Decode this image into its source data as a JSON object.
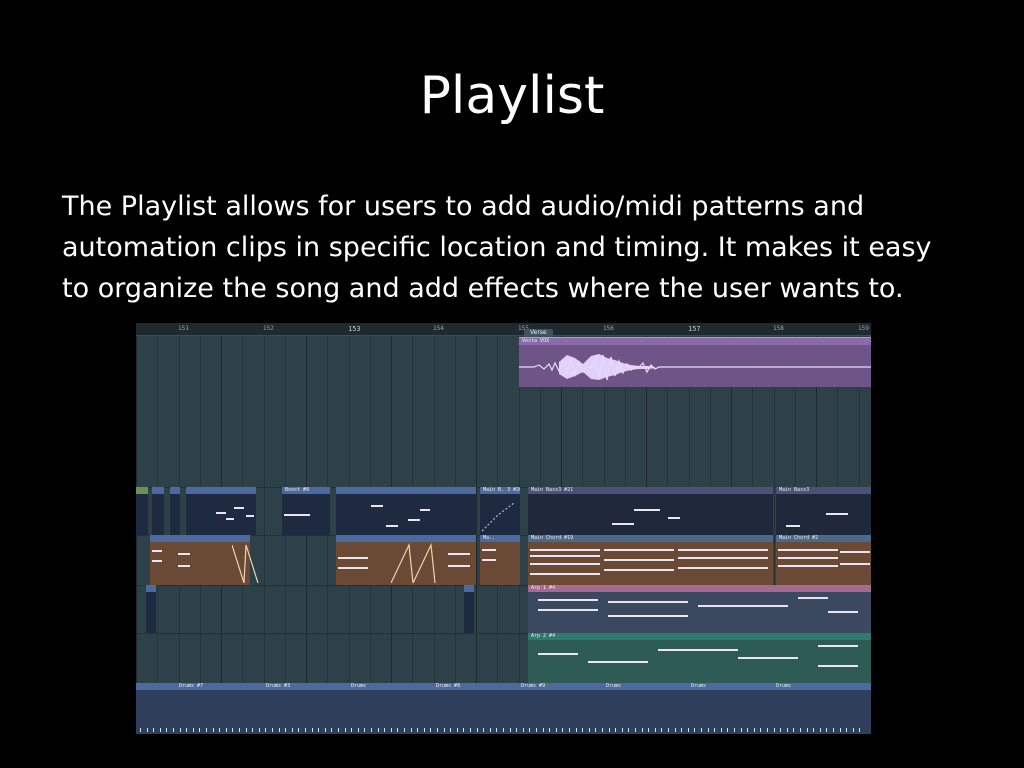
{
  "slide": {
    "title": "Playlist",
    "body": "The Playlist allows for users to add audio/midi patterns and automation clips in specific location and timing. It makes it easy to organize the song and add effects where the user wants to."
  },
  "playlist": {
    "ruler": [
      "151",
      "152",
      "153",
      "154",
      "155",
      "156",
      "157",
      "158",
      "159"
    ],
    "marker": "Verse",
    "clips": {
      "vocal": "Vesta VOX",
      "bass_boost": "Boost #8",
      "main_b": "Main B. 3 #20",
      "main_bass_21": "Main Bass3 #21",
      "main_bass3": "Main Bass3",
      "main_c": "Ma..",
      "main_chord_19": "Main Chord #19",
      "main_chord_2": "Main Chord #2",
      "arp1": "Arp 1 #4",
      "arp2": "Arp 2 #4",
      "drums7": "Drums #7",
      "drums3": "Drums #3",
      "drums": "Drums",
      "drums8": "Drums #8",
      "drums9": "Drums #9"
    },
    "colors": {
      "background": "#2f4148",
      "vocal": "#7f5d9a",
      "pattern_dark": "#1f2a40",
      "pattern_brown": "#6a4a35",
      "arp_pink": "#a56a8f",
      "arp_teal": "#2f5b55",
      "drums": "#2f3e5a"
    }
  }
}
